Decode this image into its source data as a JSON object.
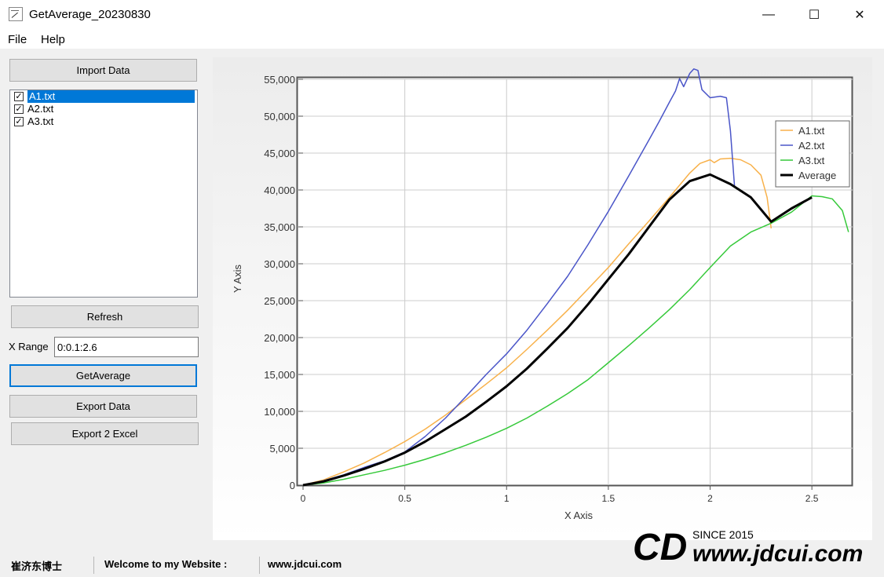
{
  "window": {
    "title": "GetAverage_20230830",
    "minimize_label": "—",
    "maximize_label": "☐",
    "close_label": "✕"
  },
  "menu": {
    "items": [
      "File",
      "Help"
    ]
  },
  "left_panel": {
    "import_label": "Import Data",
    "files": [
      {
        "name": "A1.txt",
        "checked": true,
        "selected": true
      },
      {
        "name": "A2.txt",
        "checked": true,
        "selected": false
      },
      {
        "name": "A3.txt",
        "checked": true,
        "selected": false
      }
    ],
    "refresh_label": "Refresh",
    "xrange_label": "X Range",
    "xrange_value": "0:0.1:2.6",
    "getaverage_label": "GetAverage",
    "export_label": "Export Data",
    "export_excel_label": "Export 2 Excel"
  },
  "status": {
    "name": "崔济东博士",
    "welcome": "Welcome to my Website :",
    "site": "www.jdcui.com"
  },
  "watermark": {
    "logo": "CD",
    "since": "SINCE 2015",
    "url": "www.jdcui.com"
  },
  "chart_data": {
    "type": "line",
    "xlabel": "X Axis",
    "ylabel": "Y Axis",
    "xlim": [
      0,
      2.7
    ],
    "ylim": [
      0,
      55000
    ],
    "xticks": [
      0,
      0.5,
      1,
      1.5,
      2,
      2.5
    ],
    "xtick_labels": [
      "0",
      "0.5",
      "1",
      "1.5",
      "2",
      "2.5"
    ],
    "yticks": [
      0,
      5000,
      10000,
      15000,
      20000,
      25000,
      30000,
      35000,
      40000,
      45000,
      50000,
      55000
    ],
    "ytick_labels": [
      "0",
      "5,000",
      "10,000",
      "15,000",
      "20,000",
      "25,000",
      "30,000",
      "35,000",
      "40,000",
      "45,000",
      "50,000",
      "55,000"
    ],
    "grid": true,
    "legend_position": "top-right",
    "series": [
      {
        "name": "A1.txt",
        "color": "#f8b14a",
        "width": 1.5,
        "x": [
          0,
          0.1,
          0.2,
          0.3,
          0.4,
          0.5,
          0.6,
          0.7,
          0.8,
          0.9,
          1.0,
          1.1,
          1.2,
          1.3,
          1.4,
          1.5,
          1.6,
          1.7,
          1.8,
          1.9,
          1.95,
          2.0,
          2.02,
          2.05,
          2.1,
          2.15,
          2.2,
          2.25,
          2.28,
          2.3
        ],
        "y": [
          0,
          700,
          1800,
          3000,
          4400,
          5900,
          7600,
          9500,
          11600,
          13700,
          15900,
          18400,
          21000,
          23700,
          26600,
          29500,
          32700,
          35800,
          39000,
          42300,
          43600,
          44100,
          43700,
          44200,
          44300,
          44100,
          43400,
          42000,
          39000,
          34800
        ]
      },
      {
        "name": "A2.txt",
        "color": "#4a55c8",
        "width": 1.5,
        "x": [
          0,
          0.1,
          0.2,
          0.3,
          0.4,
          0.5,
          0.6,
          0.7,
          0.8,
          0.9,
          1.0,
          1.1,
          1.2,
          1.3,
          1.4,
          1.5,
          1.6,
          1.7,
          1.75,
          1.8,
          1.83,
          1.85,
          1.87,
          1.9,
          1.92,
          1.94,
          1.96,
          2.0,
          2.05,
          2.08,
          2.1,
          2.12
        ],
        "y": [
          0,
          600,
          1400,
          2400,
          3300,
          4500,
          6600,
          9100,
          12000,
          15000,
          17800,
          21000,
          24600,
          28300,
          32600,
          37100,
          41900,
          46800,
          49300,
          51900,
          53400,
          55100,
          54000,
          55800,
          56400,
          56200,
          53600,
          52500,
          52700,
          52500,
          48000,
          40500
        ]
      },
      {
        "name": "A3.txt",
        "color": "#36c93a",
        "width": 1.5,
        "x": [
          0,
          0.1,
          0.2,
          0.3,
          0.4,
          0.5,
          0.6,
          0.7,
          0.8,
          0.9,
          1.0,
          1.1,
          1.2,
          1.3,
          1.4,
          1.5,
          1.6,
          1.7,
          1.8,
          1.9,
          2.0,
          2.1,
          2.2,
          2.3,
          2.4,
          2.5,
          2.55,
          2.6,
          2.65,
          2.68
        ],
        "y": [
          0,
          300,
          800,
          1400,
          2000,
          2700,
          3500,
          4400,
          5400,
          6500,
          7700,
          9100,
          10700,
          12400,
          14300,
          16600,
          18900,
          21300,
          23800,
          26500,
          29500,
          32400,
          34300,
          35500,
          37000,
          39200,
          39100,
          38800,
          37200,
          34300
        ]
      },
      {
        "name": "Average",
        "color": "#000000",
        "width": 3,
        "x": [
          0,
          0.1,
          0.2,
          0.3,
          0.4,
          0.5,
          0.6,
          0.7,
          0.8,
          0.9,
          1.0,
          1.1,
          1.2,
          1.3,
          1.4,
          1.5,
          1.6,
          1.7,
          1.8,
          1.9,
          2.0,
          2.1,
          2.2,
          2.3,
          2.4,
          2.5
        ],
        "y": [
          0,
          500,
          1300,
          2200,
          3200,
          4400,
          5900,
          7600,
          9300,
          11300,
          13400,
          15800,
          18500,
          21300,
          24500,
          27900,
          31300,
          35000,
          38700,
          41200,
          42100,
          40800,
          39000,
          35700,
          37500,
          39000
        ]
      }
    ]
  }
}
